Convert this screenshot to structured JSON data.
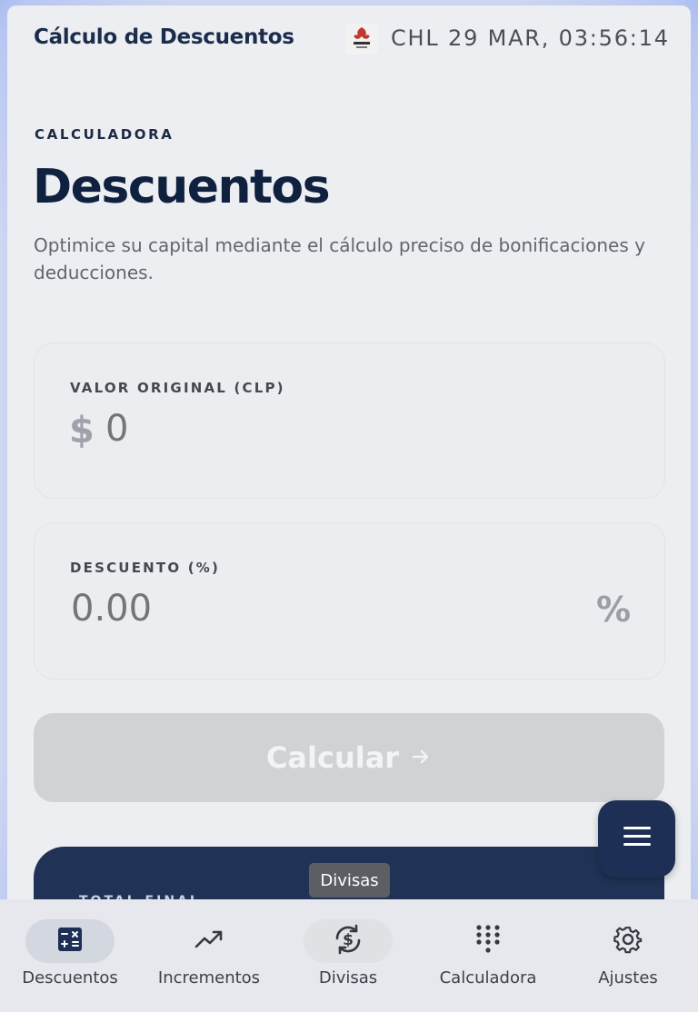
{
  "header": {
    "title": "Cálculo de Descuentos",
    "datetime": "CHL 29 MAR, 03:56:14",
    "logo_icon": "copihue-logo"
  },
  "hero": {
    "overline": "CALCULADORA",
    "title": "Descuentos",
    "subtitle": "Optimice su capital mediante el cálculo preciso de bonificaciones y deducciones."
  },
  "original_value": {
    "label": "VALOR ORIGINAL (CLP)",
    "currency_symbol": "$",
    "placeholder": "0"
  },
  "discount": {
    "label": "DESCUENTO (%)",
    "placeholder": "0.00",
    "suffix": "%"
  },
  "calculate_button": {
    "label": "Calcular",
    "icon": "arrow-right-icon"
  },
  "result": {
    "label": "TOTAL FINAL"
  },
  "tooltip": "Divisas",
  "fab_icon": "menu-icon",
  "bottom_nav": {
    "items": [
      {
        "label": "Descuentos",
        "icon": "calculator-icon",
        "active": true
      },
      {
        "label": "Incrementos",
        "icon": "trending-up-icon",
        "active": false
      },
      {
        "label": "Divisas",
        "icon": "currency-exchange-icon",
        "active": false
      },
      {
        "label": "Calculadora",
        "icon": "dialpad-icon",
        "active": false
      },
      {
        "label": "Ajustes",
        "icon": "gear-icon",
        "active": false
      }
    ]
  },
  "colors": {
    "primary": "#1d2f55",
    "background": "#eceef1",
    "disabled_button": "#d1d2d4",
    "active_nav_pill": "#d3d7df",
    "hover_nav_pill": "#e0e1e4"
  }
}
